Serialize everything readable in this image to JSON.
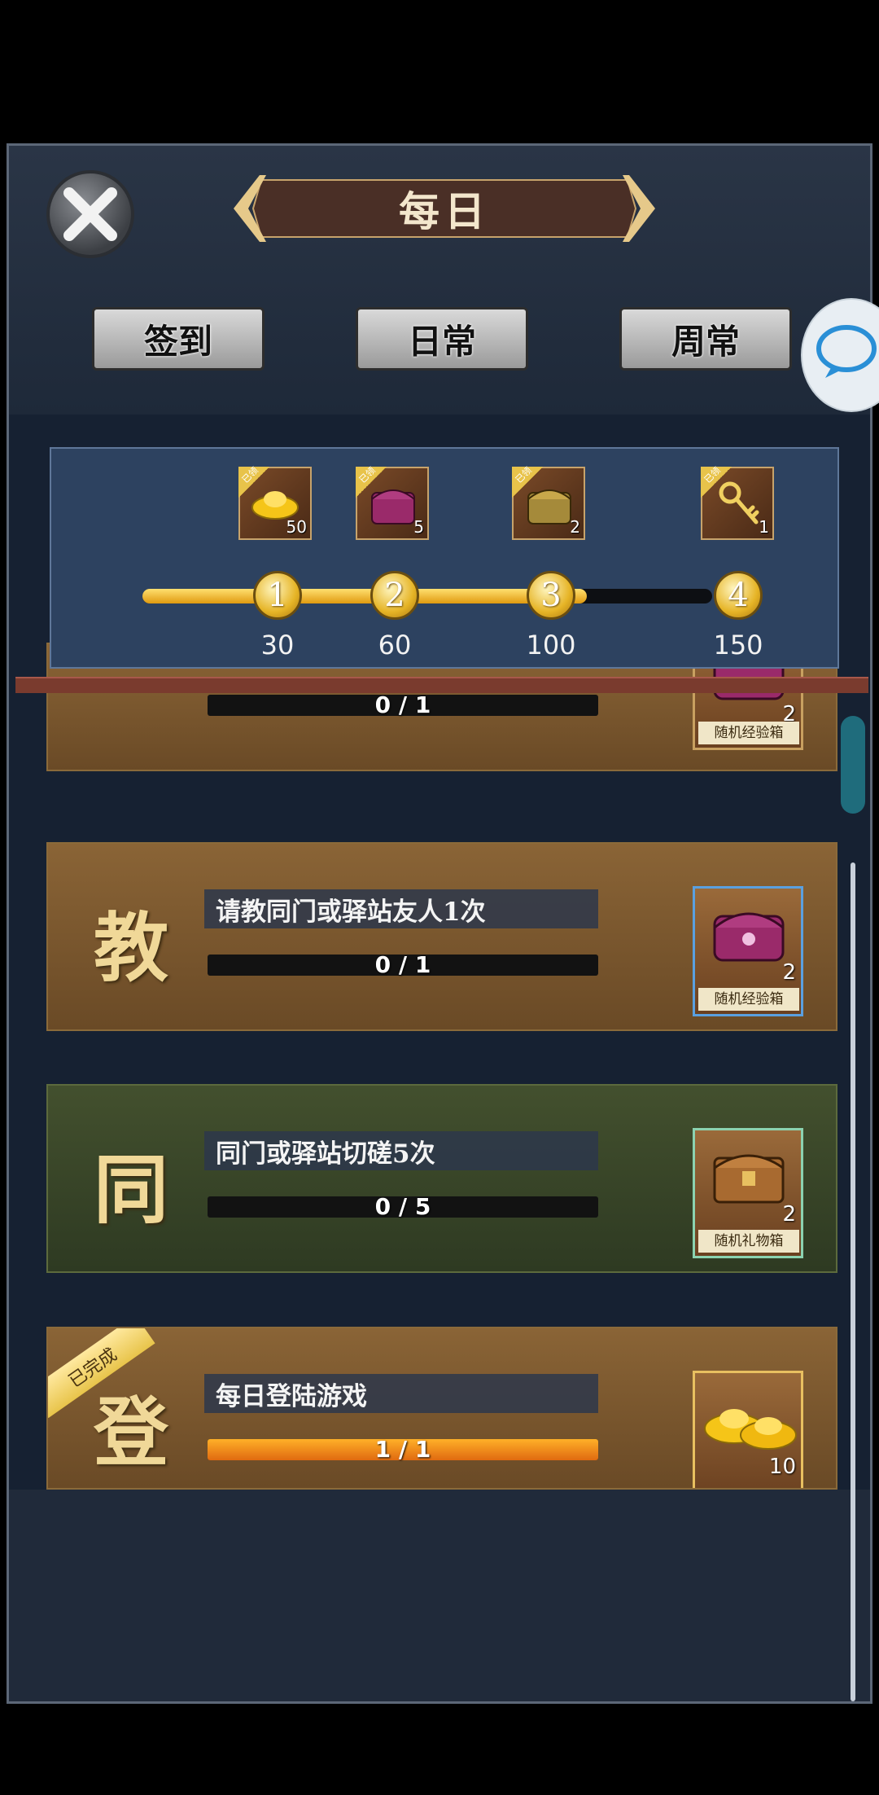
{
  "header": {
    "title": "每日",
    "close_icon": "close-icon",
    "prev_icon": "chevron-left-icon",
    "next_icon": "chevron-right-icon"
  },
  "tabs": [
    {
      "label": "签到"
    },
    {
      "label": "日常"
    },
    {
      "label": "周常"
    }
  ],
  "chat_icon": "chat-bubble-icon",
  "activity_rewards": {
    "claimed_label": "已领",
    "progress_fraction": 0.78,
    "rewards": [
      {
        "icon": "gold-ingot-icon",
        "count": "50"
      },
      {
        "icon": "purple-chest-icon",
        "count": "5"
      },
      {
        "icon": "gold-chest-icon",
        "count": "2"
      },
      {
        "icon": "key-icon",
        "count": "1"
      }
    ],
    "milestones": [
      {
        "index": "1",
        "value": "30"
      },
      {
        "index": "2",
        "value": "60"
      },
      {
        "index": "3",
        "value": "100"
      },
      {
        "index": "4",
        "value": "150"
      }
    ]
  },
  "tasks": [
    {
      "char": "",
      "desc": "",
      "progress": "0 / 1",
      "fraction": 0,
      "reward_name": "随机经验箱",
      "reward_count": "2",
      "reward_icon": "purple-chest-icon"
    },
    {
      "char": "教",
      "desc": "请教同门或驿站友人1次",
      "progress": "0 / 1",
      "fraction": 0,
      "reward_name": "随机经验箱",
      "reward_count": "2",
      "reward_icon": "purple-chest-icon"
    },
    {
      "char": "同",
      "desc": "同门或驿站切磋5次",
      "progress": "0 / 5",
      "fraction": 0,
      "reward_name": "随机礼物箱",
      "reward_count": "2",
      "reward_icon": "wooden-chest-icon"
    },
    {
      "char": "登",
      "desc": "每日登陆游戏",
      "progress": "1 / 1",
      "fraction": 1,
      "reward_name": "元宝",
      "reward_count": "10",
      "reward_icon": "gold-ingot-icon",
      "status": "已完成"
    }
  ]
}
